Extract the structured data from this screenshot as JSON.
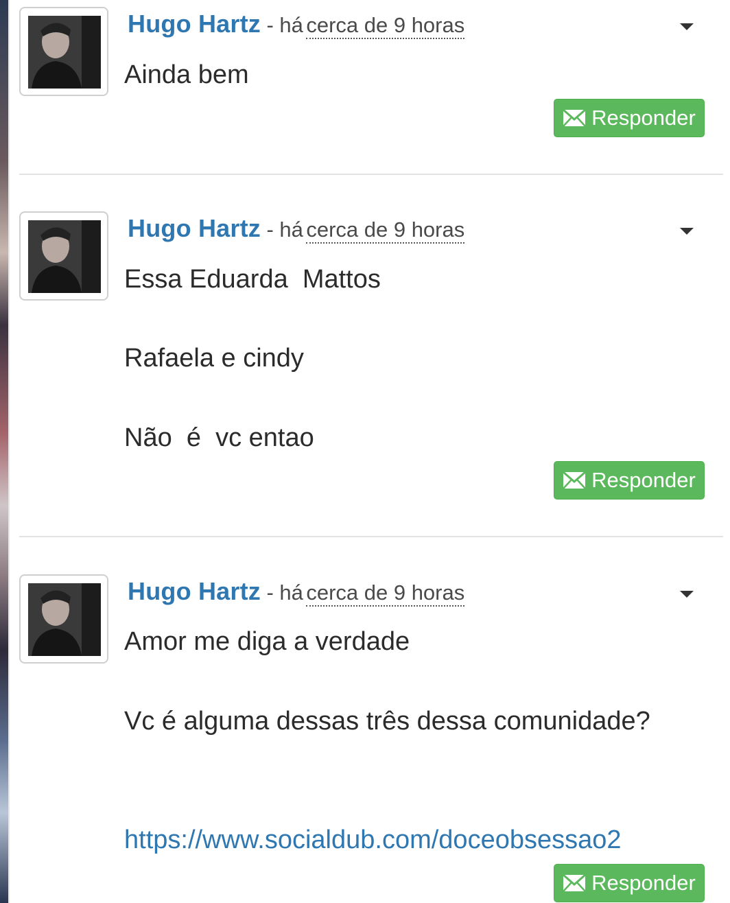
{
  "accent_color": "#2f77b1",
  "button_color": "#5cb85c",
  "comments": [
    {
      "author": "Hugo Hartz",
      "separator": "- há",
      "time": "cerca de 9 horas",
      "lines": [
        "Ainda bem"
      ],
      "reply_label": "Responder"
    },
    {
      "author": "Hugo Hartz",
      "separator": "- há",
      "time": "cerca de 9 horas",
      "lines": [
        "Essa Eduarda  Mattos",
        "Rafaela e cindy",
        "Não  é  vc entao"
      ],
      "reply_label": "Responder"
    },
    {
      "author": "Hugo Hartz",
      "separator": "- há",
      "time": "cerca de 9 horas",
      "lines": [
        "Amor me diga a verdade",
        "Vc é alguma dessas três dessa comunidade?",
        "https://www.socialdub.com/doceobsessao2"
      ],
      "reply_label": "Responder"
    }
  ],
  "icons": {
    "menu": "caret-down-icon",
    "reply": "envelope-icon"
  }
}
